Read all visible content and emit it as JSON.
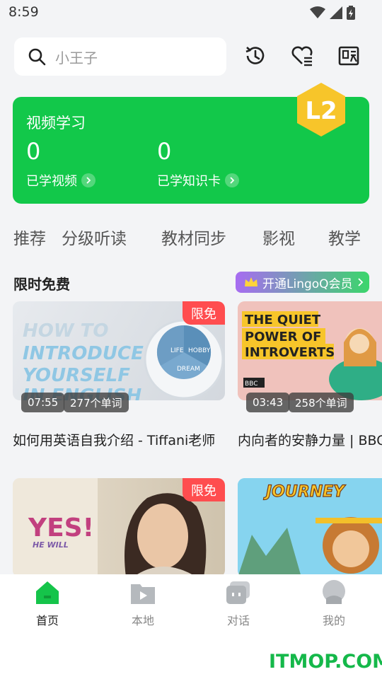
{
  "status_bar": {
    "time": "8:59"
  },
  "search": {
    "placeholder": "小王子"
  },
  "top_icons": [
    "history-icon",
    "favorite-list-icon",
    "vocabulary-icon"
  ],
  "study_card": {
    "title": "视频学习",
    "badge_text": "L2",
    "stats": [
      {
        "value": "0",
        "label": "已学视频"
      },
      {
        "value": "0",
        "label": "已学知识卡"
      }
    ]
  },
  "tabs": [
    "推荐",
    "分级听读",
    "教材同步",
    "影视",
    "教学"
  ],
  "section": {
    "title": "限时免费",
    "vip_button": "开通LingoQ会员"
  },
  "videos": [
    {
      "duration": "07:55",
      "words": "277个单词",
      "tag": "限免",
      "title": "如何用英语自我介绍 - Tiffani老师",
      "thumb_text": [
        "HOW TO",
        "INTRODUCE",
        "YOURSELF",
        "IN ENGLISH"
      ],
      "circle_labels": [
        "LIFE",
        "HOBBY",
        "DREAM"
      ]
    },
    {
      "duration": "03:43",
      "words": "258个单词",
      "tag": "",
      "title": "内向者的安静力量 | BBC",
      "thumb_text": [
        "THE QUIET",
        "POWER OF",
        "INTROVERTS"
      ],
      "logo": "BBC"
    },
    {
      "duration": "",
      "words": "",
      "tag": "限免",
      "title": "",
      "thumb_text": [
        "YES!",
        "HE WILL"
      ]
    },
    {
      "duration": "",
      "words": "",
      "tag": "",
      "title": "",
      "thumb_text": [
        "JOURNEY"
      ]
    }
  ],
  "bottom_nav": [
    {
      "label": "首页",
      "icon": "home-icon",
      "active": true
    },
    {
      "label": "本地",
      "icon": "local-video-icon",
      "active": false
    },
    {
      "label": "对话",
      "icon": "chat-icon",
      "active": false
    },
    {
      "label": "我的",
      "icon": "profile-icon",
      "active": false
    }
  ],
  "watermark": "ITMOP.COM",
  "colors": {
    "brand_green": "#12c84a",
    "free_tag": "#ff4d4f",
    "badge_yellow": "#f7c52a"
  }
}
